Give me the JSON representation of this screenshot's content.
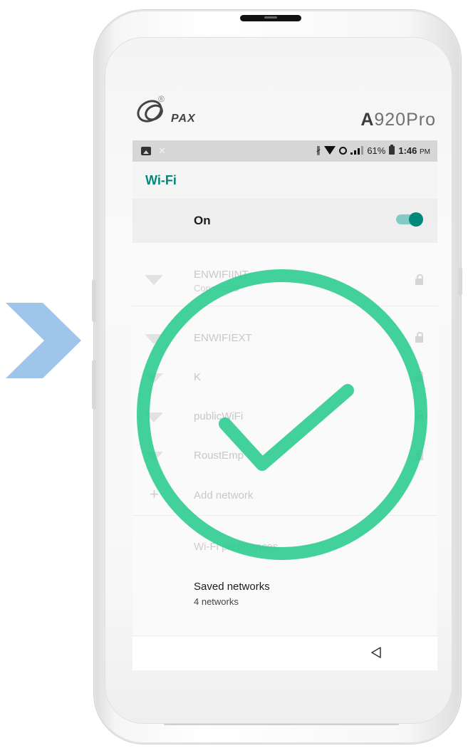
{
  "device": {
    "brand": "PAX",
    "model_strong": "A",
    "model_rest": "920Pro"
  },
  "statusbar": {
    "battery_percent": "61%",
    "time": "1:46",
    "time_suffix": "PM",
    "icons": [
      "image-icon",
      "close-icon",
      "bluetooth-icon",
      "wifi-icon",
      "cellular-icon",
      "battery-icon"
    ]
  },
  "app": {
    "title": "Wi-Fi"
  },
  "master_toggle": {
    "label": "On",
    "state": true,
    "accent": "#00897b"
  },
  "networks": [
    {
      "name": "ENWIFIINT",
      "status": "Connected",
      "locked": true
    },
    {
      "name": "ENWIFIEXT",
      "status": "",
      "locked": true
    },
    {
      "name": "K",
      "status": "",
      "locked": true
    },
    {
      "name": "publicWiFi",
      "status": "",
      "locked": true
    },
    {
      "name": "RoustEmp",
      "status": "",
      "locked": true
    }
  ],
  "add_network": {
    "label": "Add network"
  },
  "preferences": {
    "label": "Wi-Fi preferences"
  },
  "saved": {
    "label": "Saved networks",
    "count_text": "4 networks"
  },
  "overlay": {
    "checkmark_color": "#2ecc8f",
    "arrow_color": "#9fc6ea"
  }
}
